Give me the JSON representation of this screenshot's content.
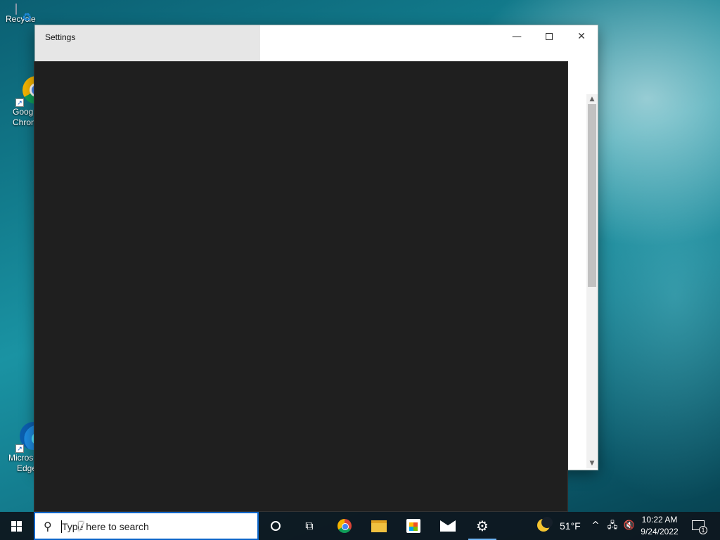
{
  "desktop": {
    "icons": [
      {
        "label": "Recycle",
        "icon": "recycle-bin-icon"
      },
      {
        "label1": "Goog",
        "label2": "Chron",
        "icon": "chrome-icon"
      },
      {
        "label1": "Micros",
        "label2": "Edge",
        "icon": "edge-icon"
      }
    ]
  },
  "window": {
    "title": "Settings",
    "controls": {
      "minimize": "—",
      "close": "✕"
    }
  },
  "taskbar": {
    "search_placeholder": "Type here to search",
    "pinned": [
      "cortana-icon",
      "task-view-icon",
      "chrome-icon",
      "file-explorer-icon",
      "microsoft-store-icon",
      "mail-icon",
      "settings-icon"
    ],
    "weather": {
      "temp": "51°F",
      "icon": "moon-icon"
    },
    "tray": {
      "chevron": "^",
      "network_icon": "network-icon",
      "volume_icon": "volume-muted-icon"
    },
    "clock": {
      "time": "10:22 AM",
      "date": "9/24/2022"
    },
    "notifications": {
      "count": "1"
    }
  },
  "colors": {
    "accent": "#0a64c8",
    "dark_panel": "#1f1f1f"
  }
}
